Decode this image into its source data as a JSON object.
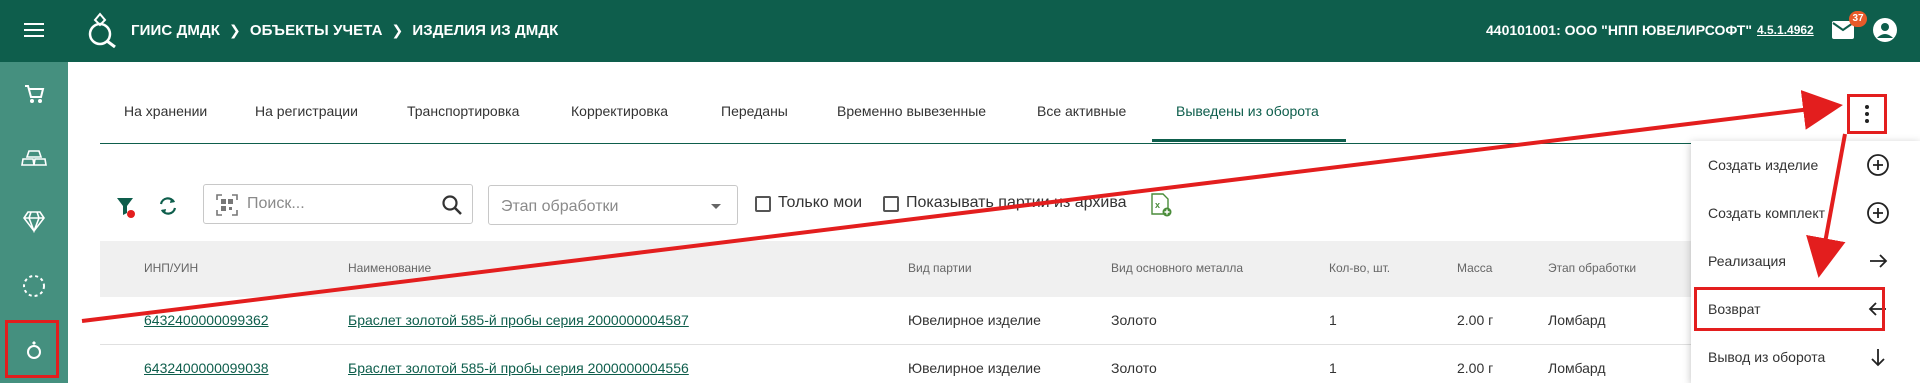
{
  "header": {
    "breadcrumb": [
      "ГИИС ДМДК",
      "ОБЪЕКТЫ УЧЕТА",
      "ИЗДЕЛИЯ ИЗ ДМДК"
    ],
    "organization": "440101001: ООО \"НПП ЮВЕЛИРСОФТ\"",
    "version": "4.5.1.4962",
    "mail_badge": "37"
  },
  "sidebar": {
    "items": [
      "cart-icon",
      "ingots-icon",
      "diamond-icon",
      "circle-dashed-icon",
      "ring-icon"
    ],
    "active_index": 4
  },
  "tabs": [
    "На хранении",
    "На регистрации",
    "Транспортировка",
    "Корректировка",
    "Переданы",
    "Временно вывезенные",
    "Все активные",
    "Выведены из оборота"
  ],
  "active_tab": "Выведены из оборота",
  "filters": {
    "search_placeholder": "Поиск...",
    "stage_placeholder": "Этап обработки",
    "only_mine": "Только мои",
    "show_archive": "Показывать партии из архива"
  },
  "table": {
    "columns": [
      "ИНП/УИН",
      "Наименование",
      "Вид партии",
      "Вид основного металла",
      "Кол-во, шт.",
      "Масса",
      "Этап обработки"
    ],
    "rows": [
      {
        "inp": "6432400000099362",
        "name": "Браслет золотой 585-й пробы серия 2000000004587",
        "batch_type": "Ювелирное изделие",
        "metal": "Золото",
        "qty": "1",
        "mass": "2.00 г",
        "stage": "Ломбард"
      },
      {
        "inp": "6432400000099038",
        "name": "Браслет золотой 585-й пробы серия 2000000004556",
        "batch_type": "Ювелирное изделие",
        "metal": "Золото",
        "qty": "1",
        "mass": "2.00 г",
        "stage": "Ломбард"
      }
    ]
  },
  "menu": {
    "items": [
      {
        "label": "Создать изделие",
        "icon": "plus-circle-icon"
      },
      {
        "label": "Создать комплект",
        "icon": "plus-circle-icon"
      },
      {
        "label": "Реализация",
        "icon": "arrow-right-icon"
      },
      {
        "label": "Возврат",
        "icon": "arrow-left-icon"
      },
      {
        "label": "Вывод из оборота",
        "icon": "arrow-down-icon"
      }
    ],
    "highlighted": "Возврат"
  },
  "colors": {
    "primary": "#0e5e4c",
    "sidebar": "#45907f",
    "annotation": "#e31e1e",
    "badge": "#e85a2a"
  }
}
